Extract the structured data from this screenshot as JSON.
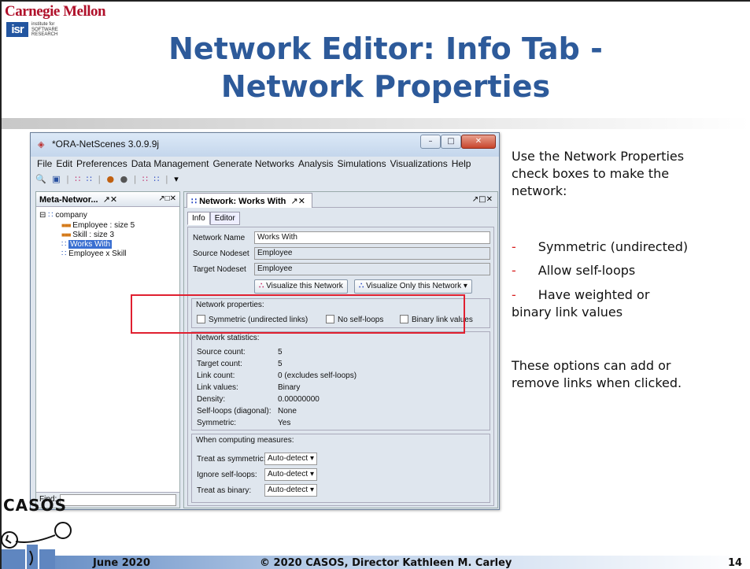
{
  "header": {
    "university": "Carnegie Mellon",
    "isr_logo": "isr",
    "isr_text": [
      "institute for",
      "SOFTWARE",
      "RESEARCH"
    ],
    "title_line1": "Network Editor: Info Tab -",
    "title_line2": "Network Properties"
  },
  "window": {
    "title": "*ORA-NetScenes 3.0.9.9j",
    "menu": [
      "File",
      "Edit",
      "Preferences",
      "Data Management",
      "Generate Networks",
      "Analysis",
      "Simulations",
      "Visualizations",
      "Help"
    ],
    "left_pane": {
      "header": "Meta-Networ...",
      "tree": {
        "root": "company",
        "items": [
          "Employee : size 5",
          "Skill : size 3",
          "Works With",
          "Employee x Skill"
        ]
      },
      "find_label": "Find:"
    },
    "right_pane": {
      "tab_title": "Network: Works With",
      "subtabs": [
        "Info",
        "Editor"
      ],
      "network_name_label": "Network Name",
      "network_name_value": "Works With",
      "source_nodeset_label": "Source Nodeset",
      "source_nodeset_value": "Employee",
      "target_nodeset_label": "Target Nodeset",
      "target_nodeset_value": "Employee",
      "visualize_button": "Visualize this Network",
      "visualize_only_button": "Visualize Only this Network",
      "properties_title": "Network properties:",
      "checkboxes": [
        "Symmetric (undirected links)",
        "No self-loops",
        "Binary link values"
      ],
      "statistics_title": "Network statistics:",
      "stats": [
        {
          "label": "Source count:",
          "value": "5"
        },
        {
          "label": "Target count:",
          "value": "5"
        },
        {
          "label": "Link count:",
          "value": "0 (excludes self-loops)"
        },
        {
          "label": "Link values:",
          "value": "Binary"
        },
        {
          "label": "Density:",
          "value": "0.00000000"
        },
        {
          "label": "Self-loops (diagonal):",
          "value": "None"
        },
        {
          "label": "Symmetric:",
          "value": "Yes"
        }
      ],
      "measures_title": "When computing measures:",
      "measures": [
        {
          "label": "Treat as symmetric:",
          "value": "Auto-detect"
        },
        {
          "label": "Ignore self-loops:",
          "value": "Auto-detect"
        },
        {
          "label": "Treat as binary:",
          "value": "Auto-detect"
        }
      ]
    }
  },
  "description": {
    "intro": [
      "Use the Network Properties",
      "check boxes to make the",
      "network:"
    ],
    "bullets": [
      "Symmetric (undirected)",
      "Allow self-loops",
      "Have weighted or"
    ],
    "bullet_cont": "binary link values",
    "note": [
      "These options can add or",
      "remove links when clicked."
    ]
  },
  "footer": {
    "casos": "CASOS",
    "date": "June 2020",
    "copyright": "© 2020 CASOS, Director Kathleen M. Carley",
    "page": "14"
  }
}
